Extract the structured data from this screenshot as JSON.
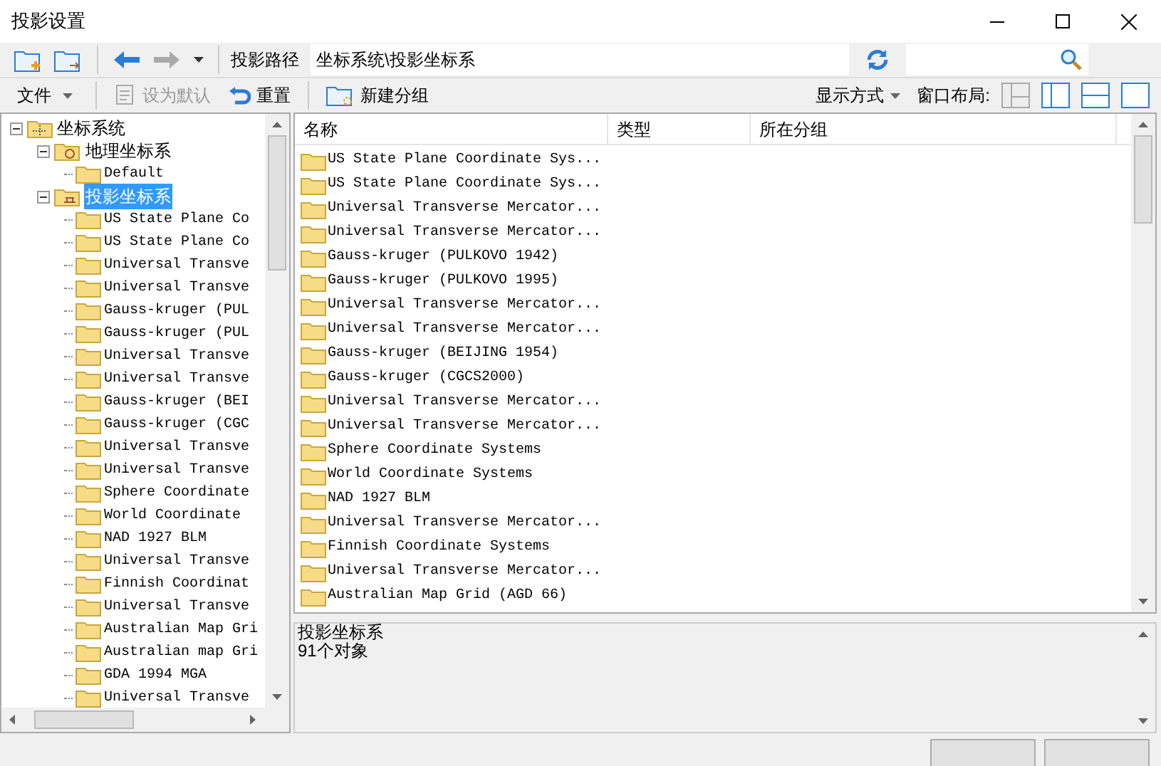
{
  "window": {
    "title": "投影设置"
  },
  "toolbar": {
    "path_label": "投影路径",
    "path_value": "坐标系统\\投影坐标系"
  },
  "toolbar2": {
    "items": [
      {
        "label": "文件",
        "kind": "menu",
        "disabled": false
      },
      {
        "label": "设为默认",
        "kind": "button",
        "disabled": true
      },
      {
        "label": "重置",
        "kind": "button",
        "disabled": false
      },
      {
        "label": "新建分组",
        "kind": "button",
        "disabled": false
      }
    ],
    "view_label": "显示方式",
    "layout_label": "窗口布局:"
  },
  "tree": {
    "label": "坐标系统",
    "expanded": true,
    "children": [
      {
        "label": "地理坐标系",
        "expanded": true,
        "selected": false,
        "children": [
          {
            "label": "Default"
          }
        ]
      },
      {
        "label": "投影坐标系",
        "expanded": true,
        "selected": true,
        "children": [
          {
            "label": "US State Plane Co"
          },
          {
            "label": "US State Plane Co"
          },
          {
            "label": "Universal Transve"
          },
          {
            "label": "Universal Transve"
          },
          {
            "label": "Gauss-kruger (PUL"
          },
          {
            "label": "Gauss-kruger (PUL"
          },
          {
            "label": "Universal Transve"
          },
          {
            "label": "Universal Transve"
          },
          {
            "label": "Gauss-kruger (BEI"
          },
          {
            "label": "Gauss-kruger (CGC"
          },
          {
            "label": "Universal Transve"
          },
          {
            "label": "Universal Transve"
          },
          {
            "label": "Sphere Coordinate"
          },
          {
            "label": "World Coordinate"
          },
          {
            "label": "NAD 1927 BLM"
          },
          {
            "label": "Universal Transve"
          },
          {
            "label": "Finnish Coordinat"
          },
          {
            "label": "Universal Transve"
          },
          {
            "label": "Australian Map Gri"
          },
          {
            "label": "Australian map Gri"
          },
          {
            "label": "GDA 1994 MGA"
          },
          {
            "label": "Universal Transve"
          }
        ]
      }
    ]
  },
  "table": {
    "columns": [
      "名称",
      "类型",
      "所在分组"
    ],
    "rows": [
      "US State Plane Coordinate Sys...",
      "US State Plane Coordinate Sys...",
      "Universal Transverse Mercator...",
      "Universal Transverse Mercator...",
      "Gauss-kruger (PULKOVO 1942)",
      "Gauss-kruger (PULKOVO 1995)",
      "Universal Transverse Mercator...",
      "Universal Transverse Mercator...",
      "Gauss-kruger (BEIJING 1954)",
      "Gauss-kruger (CGCS2000)",
      "Universal Transverse Mercator...",
      "Universal Transverse Mercator...",
      "Sphere Coordinate Systems",
      "World Coordinate Systems",
      "NAD 1927 BLM",
      "Universal Transverse Mercator...",
      "Finnish Coordinate Systems",
      "Universal Transverse Mercator...",
      "Australian Map Grid (AGD 66)"
    ]
  },
  "info": {
    "lines": [
      "投影坐标系",
      "91个对象"
    ]
  }
}
